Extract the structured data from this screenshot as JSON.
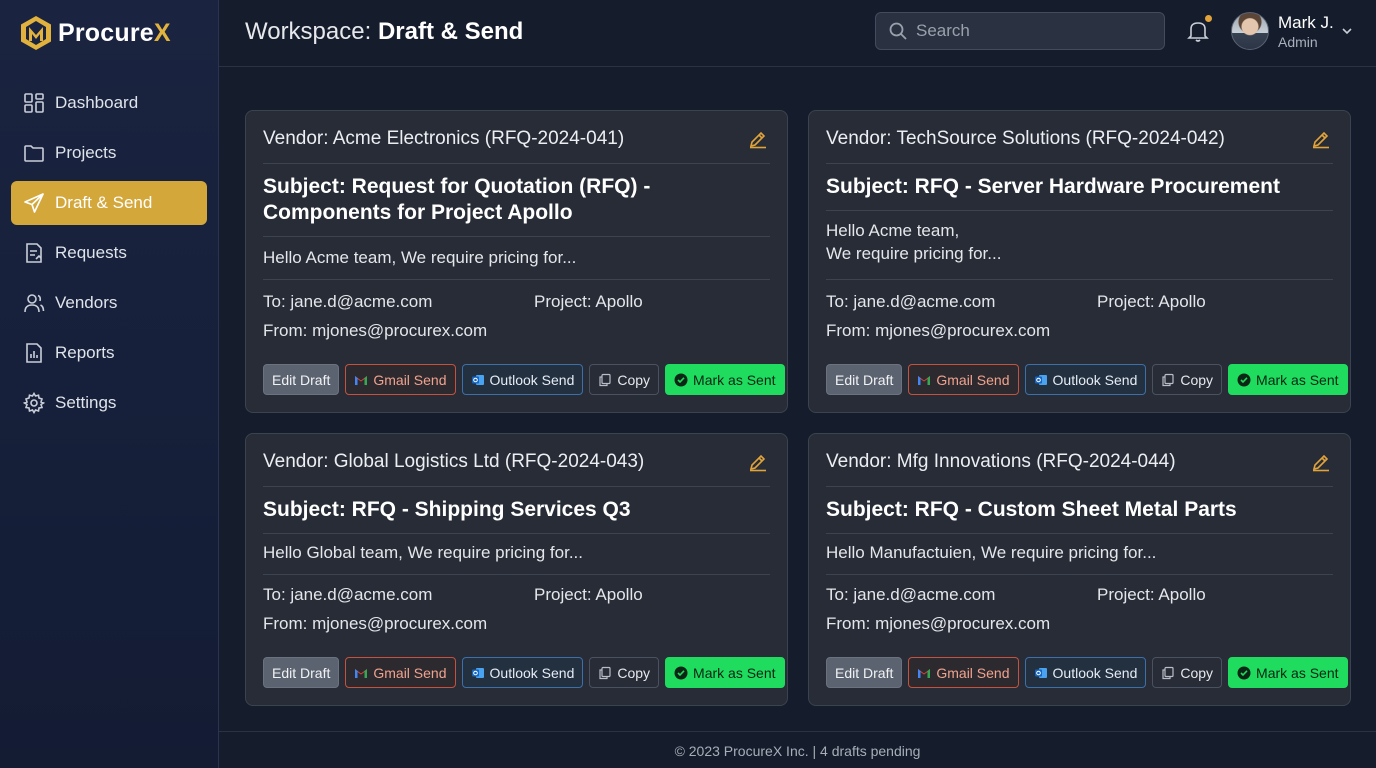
{
  "app": {
    "logo_text_main": "Procure",
    "logo_text_accent": "X"
  },
  "sidebar": {
    "items": [
      {
        "label": "Dashboard",
        "icon": "dashboard-icon"
      },
      {
        "label": "Projects",
        "icon": "folder-icon"
      },
      {
        "label": "Draft & Send",
        "icon": "send-icon",
        "active": true
      },
      {
        "label": "Requests",
        "icon": "requests-icon"
      },
      {
        "label": "Vendors",
        "icon": "users-icon"
      },
      {
        "label": "Reports",
        "icon": "reports-icon"
      },
      {
        "label": "Settings",
        "icon": "gear-icon"
      }
    ]
  },
  "header": {
    "title_prefix": "Workspace: ",
    "title_main": "Draft & Send",
    "search_placeholder": "Search",
    "user_name": "Mark J.",
    "user_role": "Admin"
  },
  "cards": [
    {
      "vendor_label": "Vendor:",
      "vendor": "Acme Electronics (RFQ-2024-041)",
      "subject": "Subject: Request for Quotation (RFQ) - Components for Project Apollo",
      "body": "Hello Acme team, We require pricing for...",
      "to": "To: jane.d@acme.com",
      "project": "Project: Apollo",
      "from": "From: mjones@procurex.com"
    },
    {
      "vendor_label": "Vendor:",
      "vendor": "TechSource Solutions (RFQ-2024-042)",
      "subject": "Subject: RFQ - Server Hardware Procurement",
      "body_line1": "Hello Acme team,",
      "body_line2": "We require pricing for...",
      "to": "To: jane.d@acme.com",
      "project": "Project: Apollo",
      "from": "From: mjones@procurex.com"
    },
    {
      "vendor_label": "Vendor:",
      "vendor": "Global Logistics Ltd (RFQ-2024-043)",
      "subject": "Subject: RFQ - Shipping Services Q3",
      "body": "Hello Global team, We require pricing for...",
      "to": "To: jane.d@acme.com",
      "project": "Project: Apollo",
      "from": "From: mjones@procurex.com"
    },
    {
      "vendor_label": "Vendor:",
      "vendor": "Mfg Innovations (RFQ-2024-044)",
      "subject": "Subject: RFQ - Custom Sheet Metal Parts",
      "body": "Hello Manufactuien, We require pricing for...",
      "to": "To: jane.d@acme.com",
      "project": "Project: Apollo",
      "from": "From: mjones@procurex.com"
    }
  ],
  "actions": {
    "edit": "Edit Draft",
    "gmail": "Gmail Send",
    "outlook": "Outlook Send",
    "copy": "Copy",
    "sent": "Mark as Sent"
  },
  "footer": {
    "text": "© 2023 ProcureX Inc. | 4 drafts pending"
  },
  "colors": {
    "accent": "#d4a73b",
    "success": "#1fdc5f",
    "gmail": "#c5523f",
    "outlook": "#3d6fa8"
  }
}
